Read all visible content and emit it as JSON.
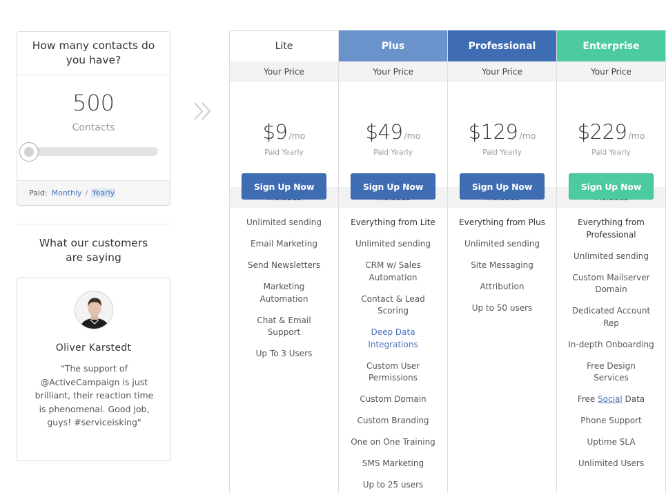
{
  "contacts_widget": {
    "title": "How many contacts do you have?",
    "count": "500",
    "unit": "Contacts",
    "paid_label": "Paid:",
    "monthly_label": "Monthly",
    "separator": "/",
    "yearly_label": "Yearly",
    "slider_value": 0
  },
  "testimonials": {
    "heading": "What our customers are saying",
    "name": "Oliver Karstedt",
    "quote": "\"The support of @ActiveCampaign is just brilliant, their reaction time is phenomenal. Good job, guys! #serviceisking\""
  },
  "pricing": {
    "plans": [
      {
        "name": "Lite",
        "header_color": "#ffffff",
        "your_price_label": "Your Price",
        "amount": "$9",
        "period": "/mo",
        "billing": "Paid Yearly",
        "button_label": "Sign Up Now",
        "button_color": "#3e6db3",
        "includes_label": "Includes",
        "features": [
          "Unlimited sending",
          "Email Marketing",
          "Send Newsletters",
          "Marketing Automation",
          "Chat & Email Support",
          "Up To 3 Users"
        ]
      },
      {
        "name": "Plus",
        "header_color": "#6a93cc",
        "your_price_label": "Your Price",
        "amount": "$49",
        "period": "/mo",
        "billing": "Paid Yearly",
        "button_label": "Sign Up Now",
        "button_color": "#3e6db3",
        "includes_label": "Includes",
        "features": [
          "Everything from Lite",
          "Unlimited sending",
          "CRM w/ Sales Automation",
          "Contact & Lead Scoring",
          "Deep Data Integrations",
          "Custom User Permissions",
          "Custom Domain",
          "Custom Branding",
          "One on One Training",
          "SMS Marketing",
          "Up to 25 users"
        ]
      },
      {
        "name": "Professional",
        "header_color": "#3e6db3",
        "your_price_label": "Your Price",
        "amount": "$129",
        "period": "/mo",
        "billing": "Paid Yearly",
        "button_label": "Sign Up Now",
        "button_color": "#3e6db3",
        "includes_label": "Includes",
        "features": [
          "Everything from Plus",
          "Unlimited sending",
          "Site Messaging",
          "Attribution",
          "Up to 50 users"
        ]
      },
      {
        "name": "Enterprise",
        "header_color": "#4ccaa1",
        "your_price_label": "Your Price",
        "amount": "$229",
        "period": "/mo",
        "billing": "Paid Yearly",
        "button_label": "Sign Up Now",
        "button_color": "#4ccaa1",
        "includes_label": "Includes",
        "features": [
          "Everything from Professional",
          "Unlimited sending",
          "Custom Mailserver Domain",
          "Dedicated Account Rep",
          "In-depth Onboarding",
          "Free Design Services",
          "Free Social Data",
          "Phone Support",
          "Uptime SLA",
          "Unlimited Users"
        ]
      }
    ]
  }
}
